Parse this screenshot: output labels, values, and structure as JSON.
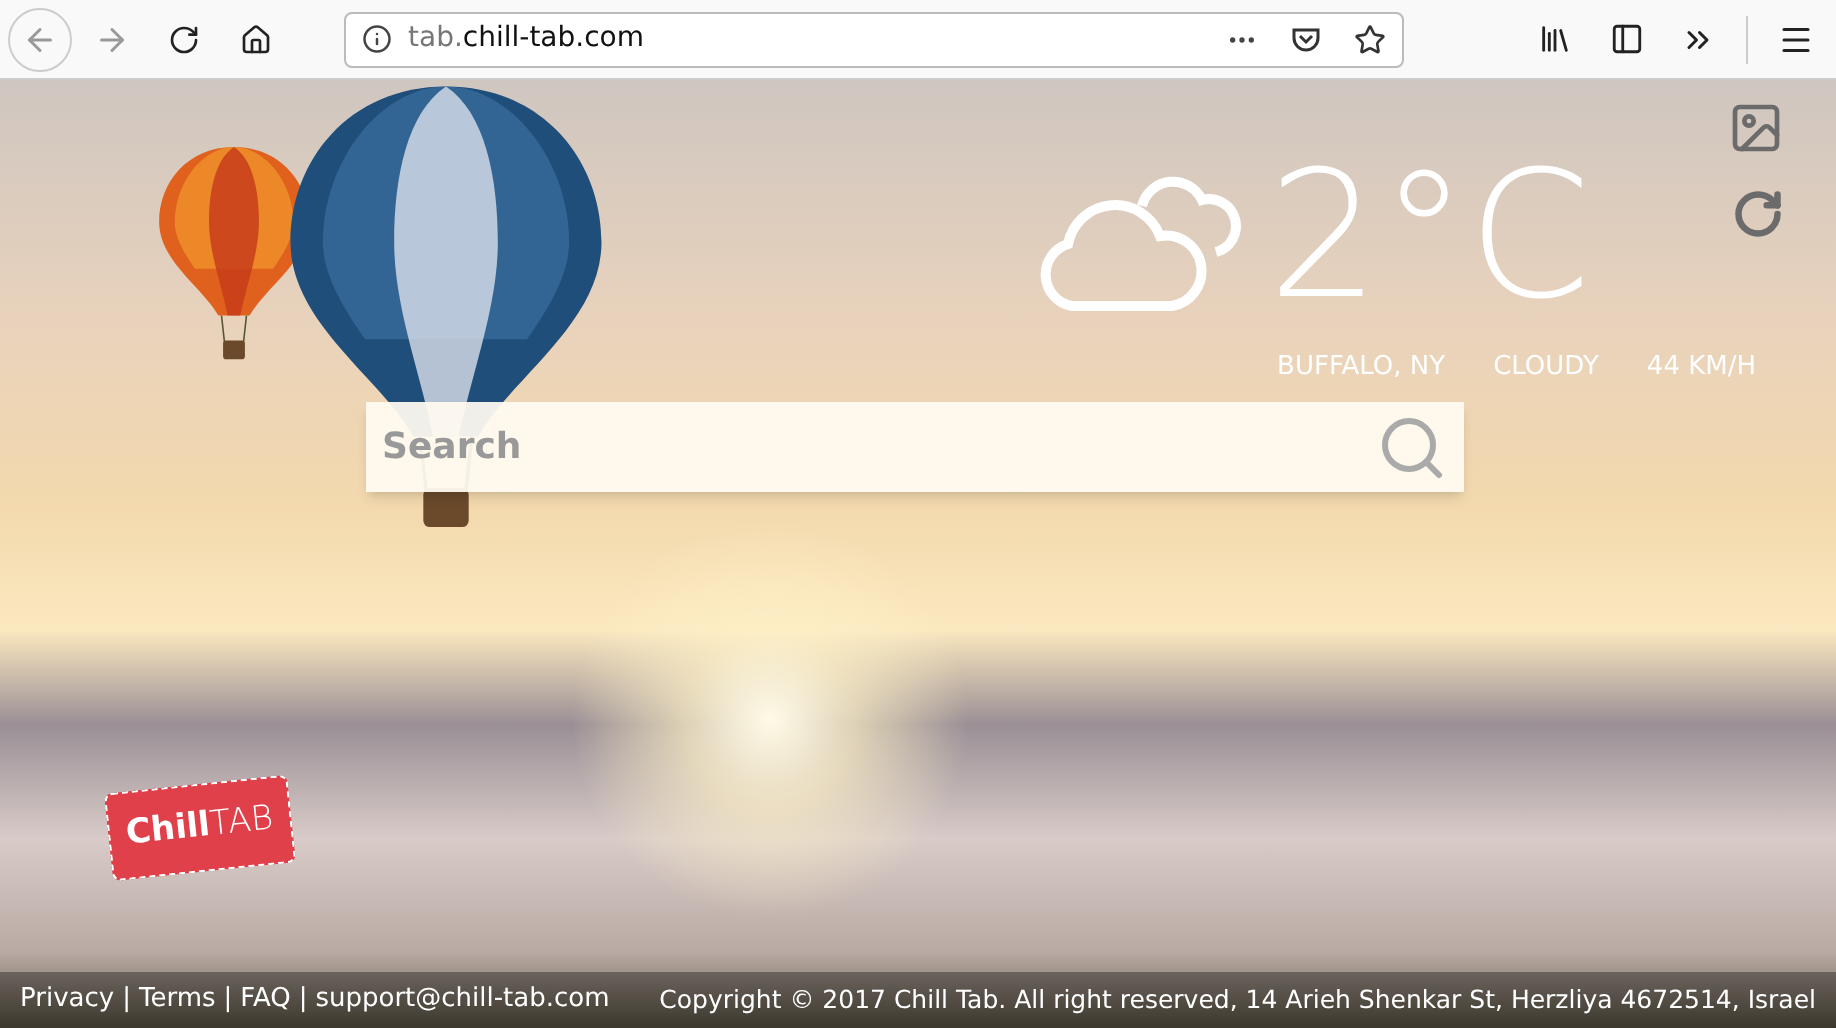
{
  "browser": {
    "url_prefix": "tab.",
    "url_domain": "chill-tab.com"
  },
  "weather": {
    "temperature": "2°C",
    "location": "BUFFALO, NY",
    "condition": "CLOUDY",
    "wind": "44 KM/H"
  },
  "search": {
    "placeholder": "Search"
  },
  "logo": {
    "part_1": "Chill",
    "part_2": "TAB"
  },
  "footer": {
    "separator": "|",
    "links": [
      "Privacy",
      "Terms",
      "FAQ",
      "support@chill-tab.com"
    ],
    "copyright": "Copyright © 2017 Chill Tab. All right reserved, 14 Arieh Shenkar St, Herzliya 4672514, Israel"
  }
}
